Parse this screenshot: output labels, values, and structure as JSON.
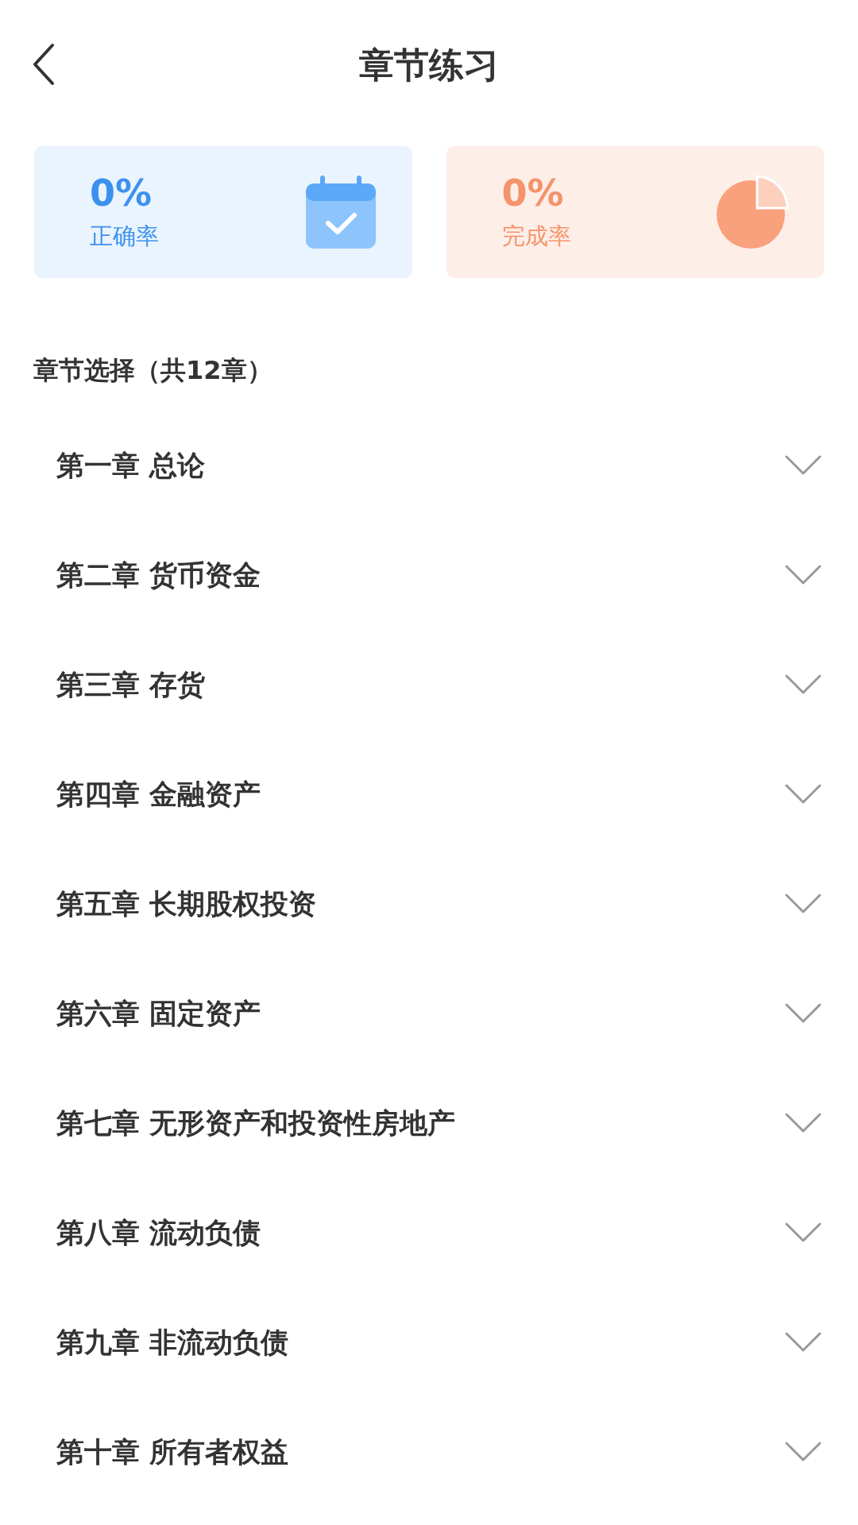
{
  "header": {
    "title": "章节练习"
  },
  "stats": [
    {
      "kind": "accuracy",
      "value": "0%",
      "label": "正确率"
    },
    {
      "kind": "completion",
      "value": "0%",
      "label": "完成率"
    }
  ],
  "section_title": "章节选择（共12章）",
  "chapters": [
    {
      "label": "第一章 总论",
      "expanded": false
    },
    {
      "label": "第二章 货币资金",
      "expanded": false
    },
    {
      "label": "第三章 存货",
      "expanded": false
    },
    {
      "label": "第四章 金融资产",
      "expanded": false
    },
    {
      "label": "第五章 长期股权投资",
      "expanded": false
    },
    {
      "label": "第六章 固定资产",
      "expanded": false
    },
    {
      "label": "第七章 无形资产和投资性房地产",
      "expanded": false
    },
    {
      "label": "第八章 流动负债",
      "expanded": false
    },
    {
      "label": "第九章 非流动负债",
      "expanded": false
    },
    {
      "label": "第十章 所有者权益",
      "expanded": false
    }
  ]
}
